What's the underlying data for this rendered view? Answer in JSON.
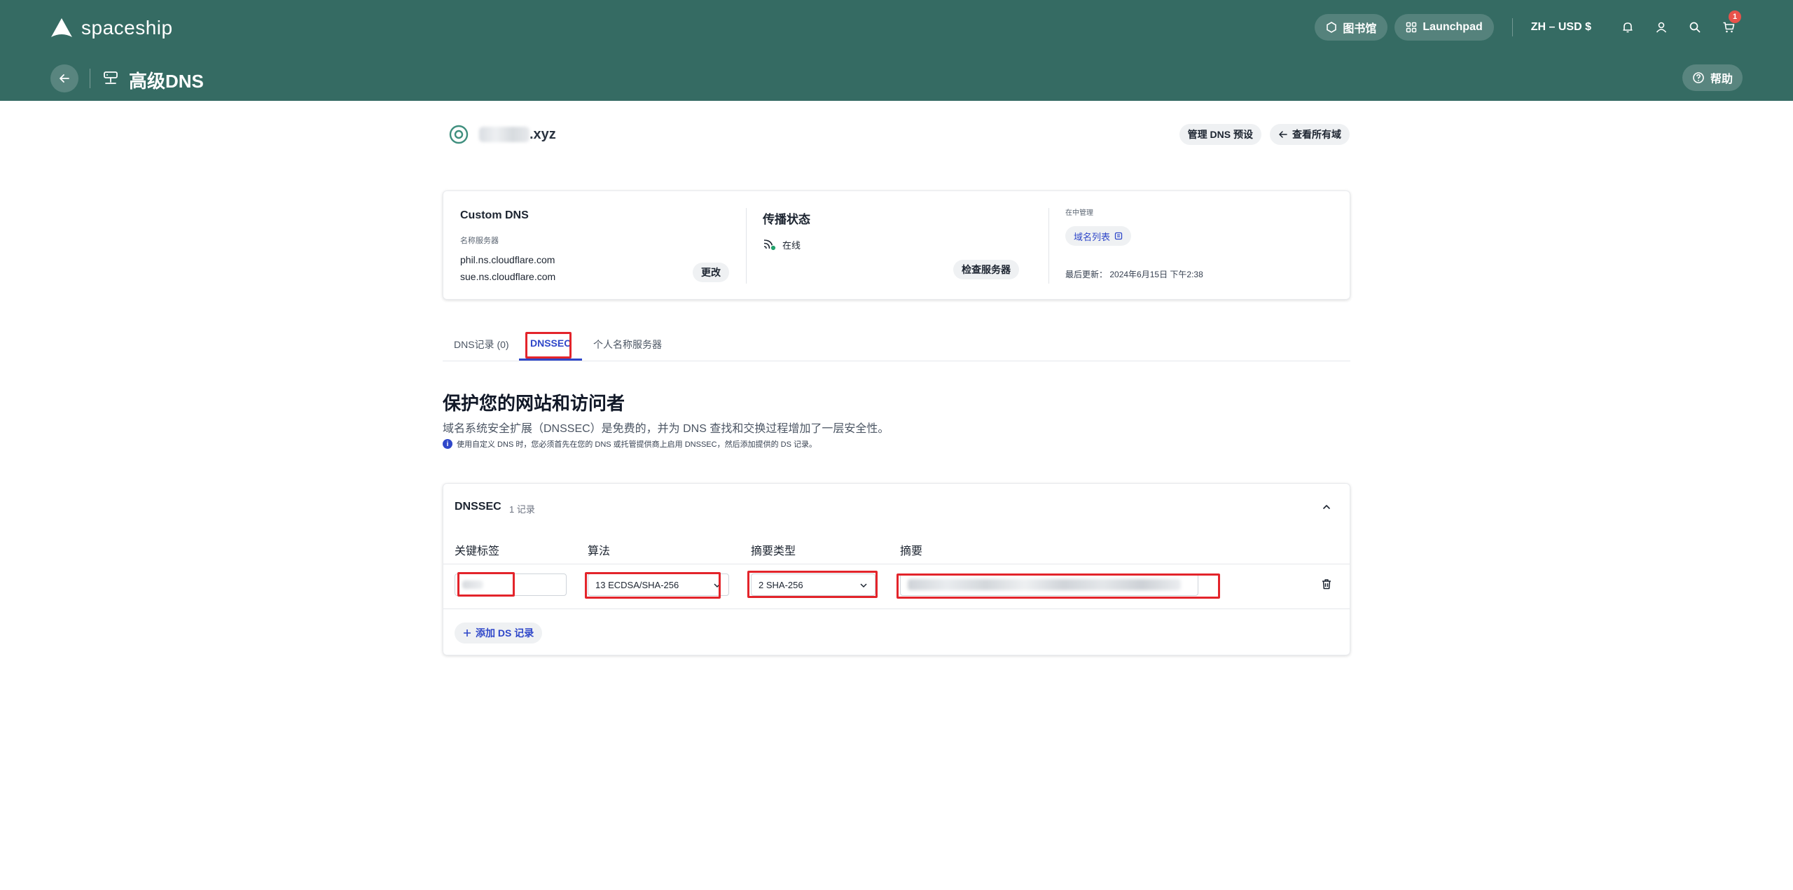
{
  "header": {
    "brand": "spaceship",
    "library_label": "图书馆",
    "launchpad_label": "Launchpad",
    "currency_label": "ZH – USD $",
    "cart_count": "1",
    "page_title": "高级DNS",
    "help_label": "帮助"
  },
  "domain": {
    "name_suffix": ".xyz",
    "manage_presets_label": "管理 DNS 预设",
    "view_all_label": "查看所有域"
  },
  "summary": {
    "dns_title": "Custom DNS",
    "nameservers_label": "名称服务器",
    "nameservers": [
      "phil.ns.cloudflare.com",
      "sue.ns.cloudflare.com"
    ],
    "change_label": "更改",
    "propagation_title": "传播状态",
    "online_label": "在线",
    "check_servers_label": "检查服务器",
    "managed_in_label": "在中管理",
    "domain_list_label": "域名列表",
    "last_updated_label": "最后更新：",
    "last_updated_value": "2024年6月15日 下午2:38"
  },
  "tabs": [
    {
      "label": "DNS记录 (0)"
    },
    {
      "label": "DNSSEC"
    },
    {
      "label": "个人名称服务器"
    }
  ],
  "dnssec": {
    "title": "保护您的网站和访问者",
    "description": "域名系统安全扩展（DNSSEC）是免费的，并为 DNS 查找和交换过程增加了一层安全性。",
    "note": "使用自定义 DNS 时，您必须首先在您的 DNS 或托管提供商上启用 DNSSEC，然后添加提供的 DS 记录。",
    "panel_title": "DNSSEC",
    "record_count": "1 记录",
    "columns": [
      "关键标签",
      "算法",
      "摘要类型",
      "摘要"
    ],
    "record": {
      "algorithm": "13 ECDSA/SHA-256",
      "digest_type": "2 SHA-256"
    },
    "add_label": "添加 DS 记录"
  },
  "colors": {
    "header_bg": "#356b63",
    "accent": "#2f47c9",
    "highlight_box": "#e3242b",
    "online_dot": "#22a06b"
  }
}
